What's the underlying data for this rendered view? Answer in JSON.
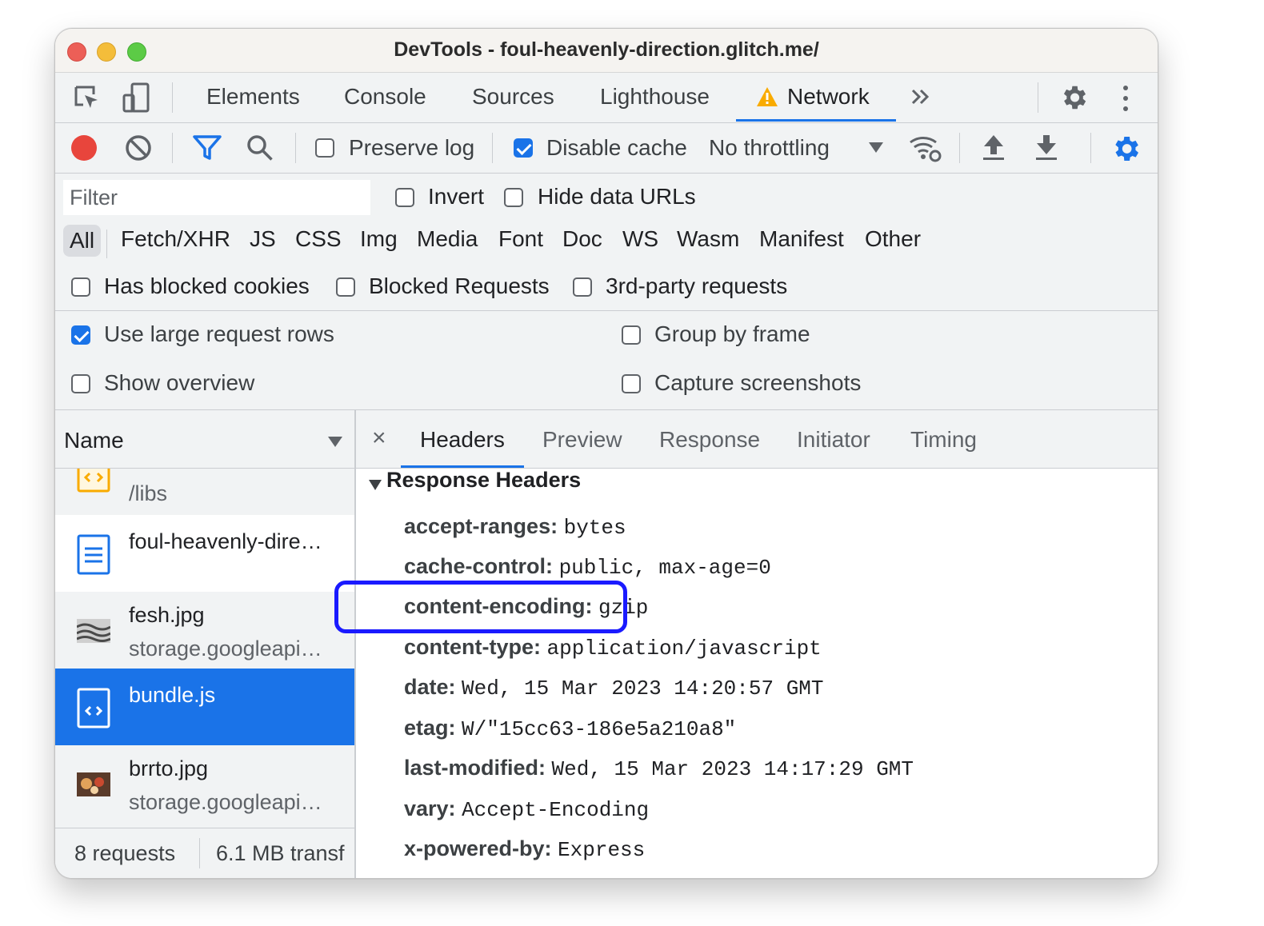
{
  "window": {
    "title": "DevTools - foul-heavenly-direction.glitch.me/"
  },
  "tabs": [
    "Elements",
    "Console",
    "Sources",
    "Lighthouse",
    "Network"
  ],
  "active_tab": "Network",
  "toolbar": {
    "preserve_log": "Preserve log",
    "disable_cache": "Disable cache",
    "throttling": "No throttling"
  },
  "filter": {
    "placeholder": "Filter",
    "invert": "Invert",
    "hide_data_urls": "Hide data URLs",
    "types": [
      "All",
      "Fetch/XHR",
      "JS",
      "CSS",
      "Img",
      "Media",
      "Font",
      "Doc",
      "WS",
      "Wasm",
      "Manifest",
      "Other"
    ],
    "has_blocked_cookies": "Has blocked cookies",
    "blocked_requests": "Blocked Requests",
    "third_party": "3rd-party requests"
  },
  "settings": {
    "large_rows": "Use large request rows",
    "group_by_frame": "Group by frame",
    "show_overview": "Show overview",
    "capture_screenshots": "Capture screenshots"
  },
  "requests": {
    "column": "Name",
    "items": [
      {
        "name": "",
        "sub": "/libs"
      },
      {
        "name": "foul-heavenly-dire…",
        "sub": ""
      },
      {
        "name": "fesh.jpg",
        "sub": "storage.googleapi…"
      },
      {
        "name": "bundle.js",
        "sub": ""
      },
      {
        "name": "brrto.jpg",
        "sub": "storage.googleapi…"
      }
    ]
  },
  "status": {
    "count": "8 requests",
    "transferred": "6.1 MB transf"
  },
  "detail": {
    "close": "×",
    "tabs": [
      "Headers",
      "Preview",
      "Response",
      "Initiator",
      "Timing"
    ],
    "section": "Response Headers",
    "headers": [
      {
        "key": "accept-ranges:",
        "value": "bytes"
      },
      {
        "key": "cache-control:",
        "value": "public, max-age=0"
      },
      {
        "key": "content-encoding:",
        "value": "gzip"
      },
      {
        "key": "content-type:",
        "value": "application/javascript"
      },
      {
        "key": "date:",
        "value": "Wed, 15 Mar 2023 14:20:57 GMT"
      },
      {
        "key": "etag:",
        "value": "W/\"15cc63-186e5a210a8\""
      },
      {
        "key": "last-modified:",
        "value": "Wed, 15 Mar 2023 14:17:29 GMT"
      },
      {
        "key": "vary:",
        "value": "Accept-Encoding"
      },
      {
        "key": "x-powered-by:",
        "value": "Express"
      }
    ]
  },
  "colors": {
    "accent": "#1a73e8",
    "highlight": "#1a1aff",
    "record": "#e8453c",
    "warning": "#f9ab00"
  }
}
